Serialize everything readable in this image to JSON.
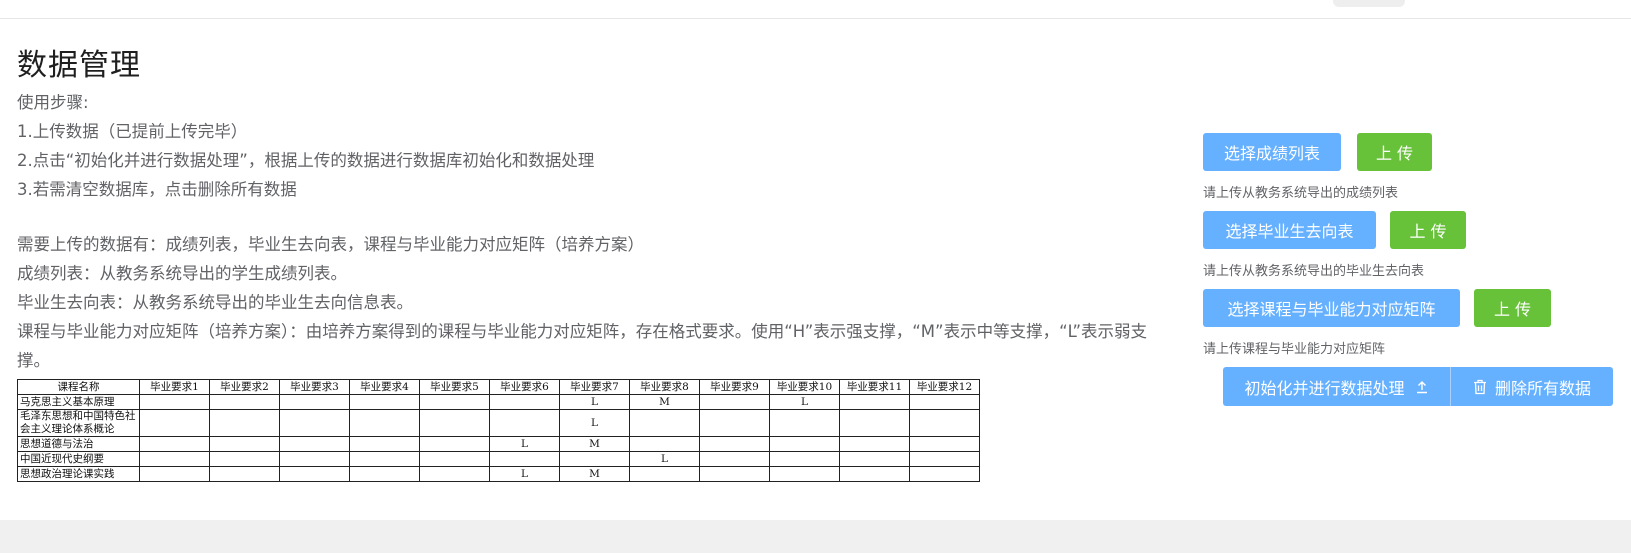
{
  "page": {
    "title": "数据管理"
  },
  "steps": {
    "heading": "使用步骤:",
    "items": [
      "1.上传数据（已提前上传完毕）",
      "2.点击“初始化并进行数据处理”，根据上传的数据进行数据库初始化和数据处理",
      "3.若需清空数据库，点击删除所有数据"
    ]
  },
  "requirements": {
    "intro": "需要上传的数据有：成绩列表，毕业生去向表，课程与毕业能力对应矩阵（培养方案）",
    "grades": "成绩列表：从教务系统导出的学生成绩列表。",
    "graduates": "毕业生去向表：从教务系统导出的毕业生去向信息表。",
    "matrix": "课程与毕业能力对应矩阵（培养方案）：由培养方案得到的课程与毕业能力对应矩阵，存在格式要求。使用“H”表示强支撑，“M”表示中等支撑，“L”表示弱支撑。"
  },
  "matrix_table": {
    "headers": [
      "课程名称",
      "毕业要求1",
      "毕业要求2",
      "毕业要求3",
      "毕业要求4",
      "毕业要求5",
      "毕业要求6",
      "毕业要求7",
      "毕业要求8",
      "毕业要求9",
      "毕业要求10",
      "毕业要求11",
      "毕业要求12"
    ],
    "rows": [
      [
        "马克思主义基本原理",
        "",
        "",
        "",
        "",
        "",
        "",
        "L",
        "M",
        "",
        "L",
        "",
        ""
      ],
      [
        "毛泽东思想和中国特色社会主义理论体系概论",
        "",
        "",
        "",
        "",
        "",
        "",
        "L",
        "",
        "",
        "",
        "",
        ""
      ],
      [
        "思想道德与法治",
        "",
        "",
        "",
        "",
        "",
        "L",
        "M",
        "",
        "",
        "",
        "",
        ""
      ],
      [
        "中国近现代史纲要",
        "",
        "",
        "",
        "",
        "",
        "",
        "",
        "L",
        "",
        "",
        "",
        ""
      ],
      [
        "思想政治理论课实践",
        "",
        "",
        "",
        "",
        "",
        "L",
        "M",
        "",
        "",
        "",
        "",
        ""
      ]
    ]
  },
  "uploads": {
    "grades": {
      "select_label": "选择成绩列表",
      "upload_label": "上 传",
      "tip": "请上传从教务系统导出的成绩列表"
    },
    "graduates": {
      "select_label": "选择毕业生去向表",
      "upload_label": "上 传",
      "tip": "请上传从教务系统导出的毕业生去向表"
    },
    "matrix": {
      "select_label": "选择课程与毕业能力对应矩阵",
      "upload_label": "上 传",
      "tip": "请上传课程与毕业能力对应矩阵"
    }
  },
  "actions": {
    "init_label": "初始化并进行数据处理",
    "init_icon": "upload-icon",
    "delete_label": "删除所有数据",
    "delete_icon": "trash-icon"
  },
  "colors": {
    "primary_light": "#66b1ff",
    "success": "#67c23a",
    "background": "#f0f0f0"
  }
}
